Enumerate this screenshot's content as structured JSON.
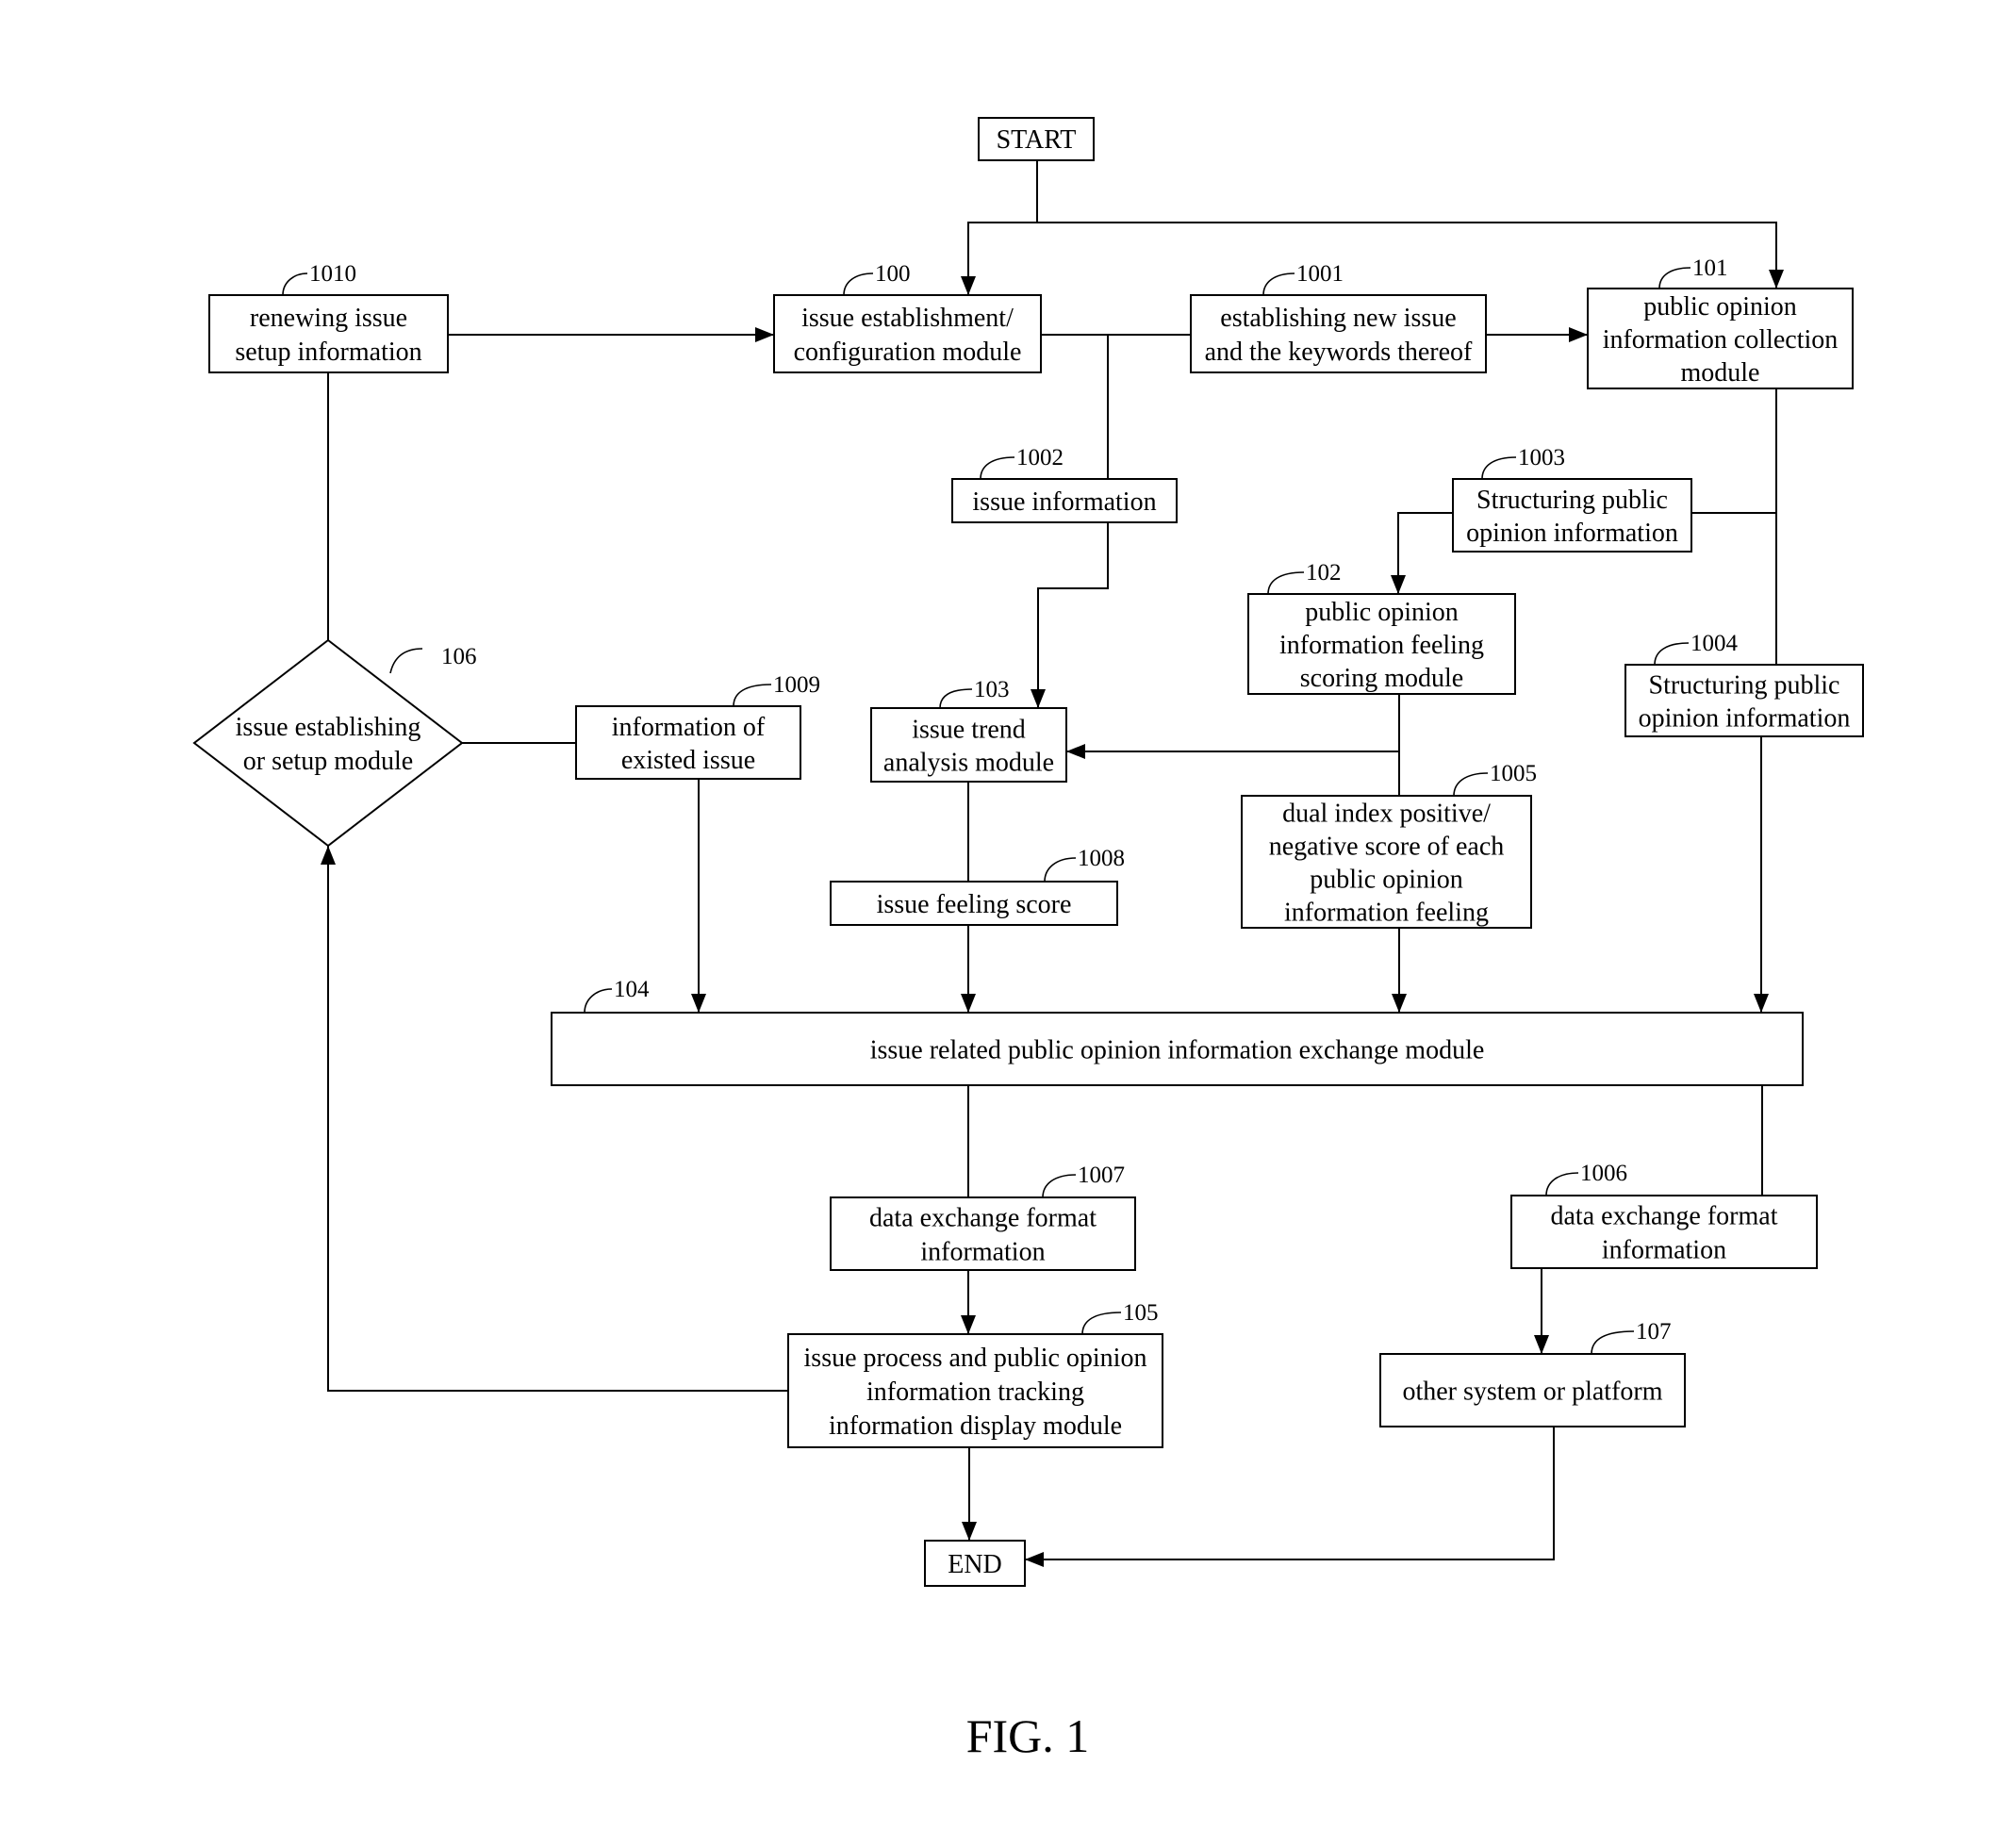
{
  "figure_label": "FIG. 1",
  "terminals": {
    "start": "START",
    "end": "END"
  },
  "nodes": {
    "n1010": {
      "ref": "1010",
      "lines": [
        "renewing issue",
        "setup information"
      ]
    },
    "n100": {
      "ref": "100",
      "lines": [
        "issue establishment/",
        "configuration module"
      ]
    },
    "n1001": {
      "ref": "1001",
      "lines": [
        "establishing new issue",
        "and the keywords thereof"
      ]
    },
    "n101": {
      "ref": "101",
      "lines": [
        "public opinion",
        "information collection",
        "module"
      ]
    },
    "n1002": {
      "ref": "1002",
      "lines": [
        "issue information"
      ]
    },
    "n1003": {
      "ref": "1003",
      "lines": [
        "Structuring public",
        "opinion information"
      ]
    },
    "n102": {
      "ref": "102",
      "lines": [
        "public opinion",
        "information feeling",
        "scoring module"
      ]
    },
    "n1004": {
      "ref": "1004",
      "lines": [
        "Structuring public",
        "opinion information"
      ]
    },
    "n106": {
      "ref": "106",
      "lines": [
        "issue establishing",
        "or setup module"
      ]
    },
    "n1009": {
      "ref": "1009",
      "lines": [
        "information of",
        "existed issue"
      ]
    },
    "n103": {
      "ref": "103",
      "lines": [
        "issue trend",
        "analysis module"
      ]
    },
    "n1005": {
      "ref": "1005",
      "lines": [
        "dual index positive/",
        "negative score of each",
        "public opinion",
        "information feeling"
      ]
    },
    "n1008": {
      "ref": "1008",
      "lines": [
        "issue feeling score"
      ]
    },
    "n104": {
      "ref": "104",
      "lines": [
        "issue related public opinion information exchange module"
      ]
    },
    "n1007": {
      "ref": "1007",
      "lines": [
        "data exchange format",
        "information"
      ]
    },
    "n1006": {
      "ref": "1006",
      "lines": [
        "data exchange format",
        "information"
      ]
    },
    "n105": {
      "ref": "105",
      "lines": [
        "issue process and public opinion",
        "information tracking",
        "information display module"
      ]
    },
    "n107": {
      "ref": "107",
      "lines": [
        "other system or platform"
      ]
    }
  },
  "edges": [
    {
      "from": "START",
      "to": "100"
    },
    {
      "from": "START",
      "to": "101"
    },
    {
      "from": "1010",
      "to": "100"
    },
    {
      "from": "100",
      "to": "1001"
    },
    {
      "from": "1001",
      "to": "101"
    },
    {
      "from": "100",
      "to": "1002"
    },
    {
      "from": "1002",
      "to": "103"
    },
    {
      "from": "101",
      "to": "1003"
    },
    {
      "from": "1003",
      "to": "102"
    },
    {
      "from": "101",
      "to": "1004"
    },
    {
      "from": "102",
      "to": "103"
    },
    {
      "from": "102",
      "to": "1005"
    },
    {
      "from": "106",
      "to": "1010"
    },
    {
      "from": "106",
      "to": "1009"
    },
    {
      "from": "1009",
      "to": "104"
    },
    {
      "from": "103",
      "to": "1008"
    },
    {
      "from": "1008",
      "to": "104"
    },
    {
      "from": "1005",
      "to": "104"
    },
    {
      "from": "1004",
      "to": "104"
    },
    {
      "from": "104",
      "to": "1007"
    },
    {
      "from": "104",
      "to": "1006"
    },
    {
      "from": "1007",
      "to": "105"
    },
    {
      "from": "1006",
      "to": "107"
    },
    {
      "from": "105",
      "to": "106"
    },
    {
      "from": "105",
      "to": "END"
    },
    {
      "from": "107",
      "to": "END"
    }
  ]
}
